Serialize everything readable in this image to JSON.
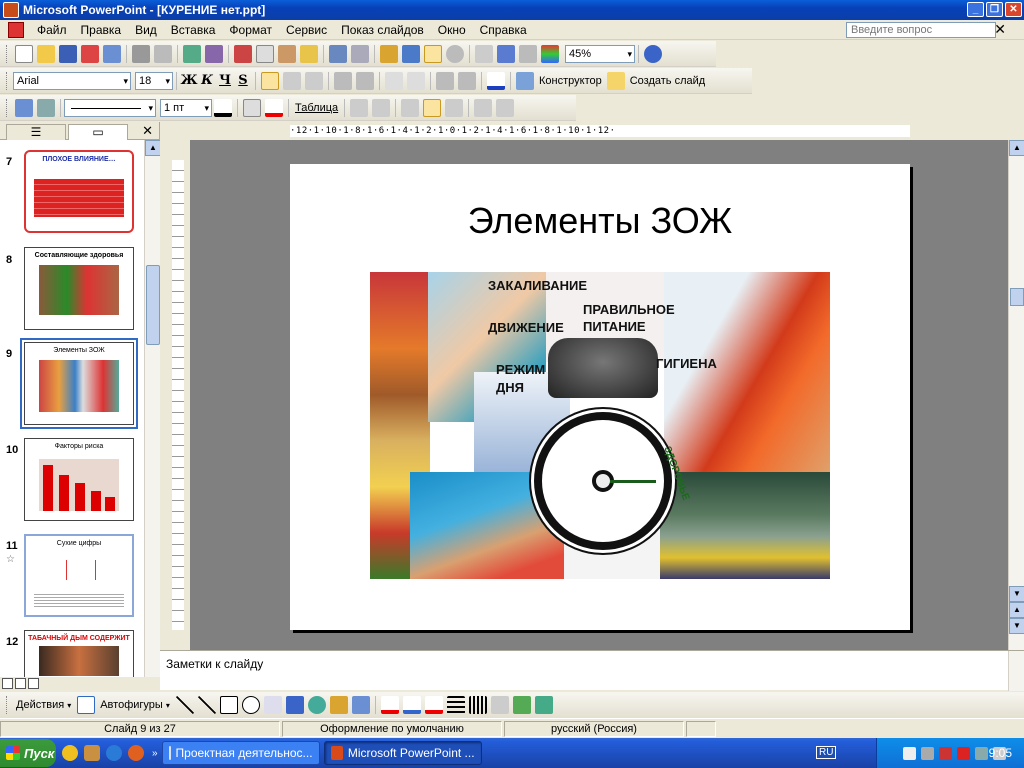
{
  "window": {
    "title": "Microsoft PowerPoint - [КУРЕНИЕ нет.ppt]"
  },
  "menu": {
    "items": [
      "Файл",
      "Правка",
      "Вид",
      "Вставка",
      "Формат",
      "Сервис",
      "Показ слайдов",
      "Окно",
      "Справка"
    ],
    "ask_placeholder": "Введите вопрос"
  },
  "toolbar_standard": {
    "zoom": "45%"
  },
  "toolbar_format": {
    "font": "Arial",
    "size": "18",
    "bold": "Ж",
    "italic": "К",
    "underline": "Ч",
    "shadow": "S",
    "designer": "Конструктор",
    "new_slide": "Создать слайд"
  },
  "toolbar_tables": {
    "line_width": "1 пт",
    "table_menu": "Таблица"
  },
  "ruler_h": "·12·1·10·1·8·1·6·1·4·1·2·1·0·1·2·1·4·1·6·1·8·1·10·1·12·",
  "slides_panel": {
    "slides": [
      {
        "number": "7",
        "title": "ПЛОХОЕ ВЛИЯНИЕ…"
      },
      {
        "number": "8",
        "title": "Составляющие здоровья"
      },
      {
        "number": "9",
        "title": "Элементы ЗОЖ"
      },
      {
        "number": "10",
        "title": "Факторы риска"
      },
      {
        "number": "11",
        "title": "Сухие цифры"
      },
      {
        "number": "12",
        "title": "ТАБАЧНЫЙ ДЫМ СОДЕРЖИТ"
      }
    ],
    "selected_index": 2
  },
  "slide": {
    "title": "Элементы ЗОЖ",
    "labels": {
      "hardening": "ЗАКАЛИВАНИЕ",
      "movement": "ДВИЖЕНИЕ",
      "nutrition_1": "ПРАВИЛЬНОЕ",
      "nutrition_2": "ПИТАНИЕ",
      "regime_1": "РЕЖИМ",
      "regime_2": "ДНЯ",
      "hygiene": "ГИГИЕНА",
      "health": "ЗДОРОВЬЕ"
    }
  },
  "notes": {
    "placeholder": "Заметки к слайду"
  },
  "drawing_toolbar": {
    "actions": "Действия",
    "autoshapes": "Автофигуры"
  },
  "status": {
    "slide": "Слайд 9 из 27",
    "design": "Оформление по умолчанию",
    "language": "русский (Россия)"
  },
  "taskbar": {
    "start": "Пуск",
    "tasks": [
      "Проектная деятельнос...",
      "Microsoft PowerPoint ..."
    ],
    "lang": "RU",
    "time": "9:05"
  }
}
